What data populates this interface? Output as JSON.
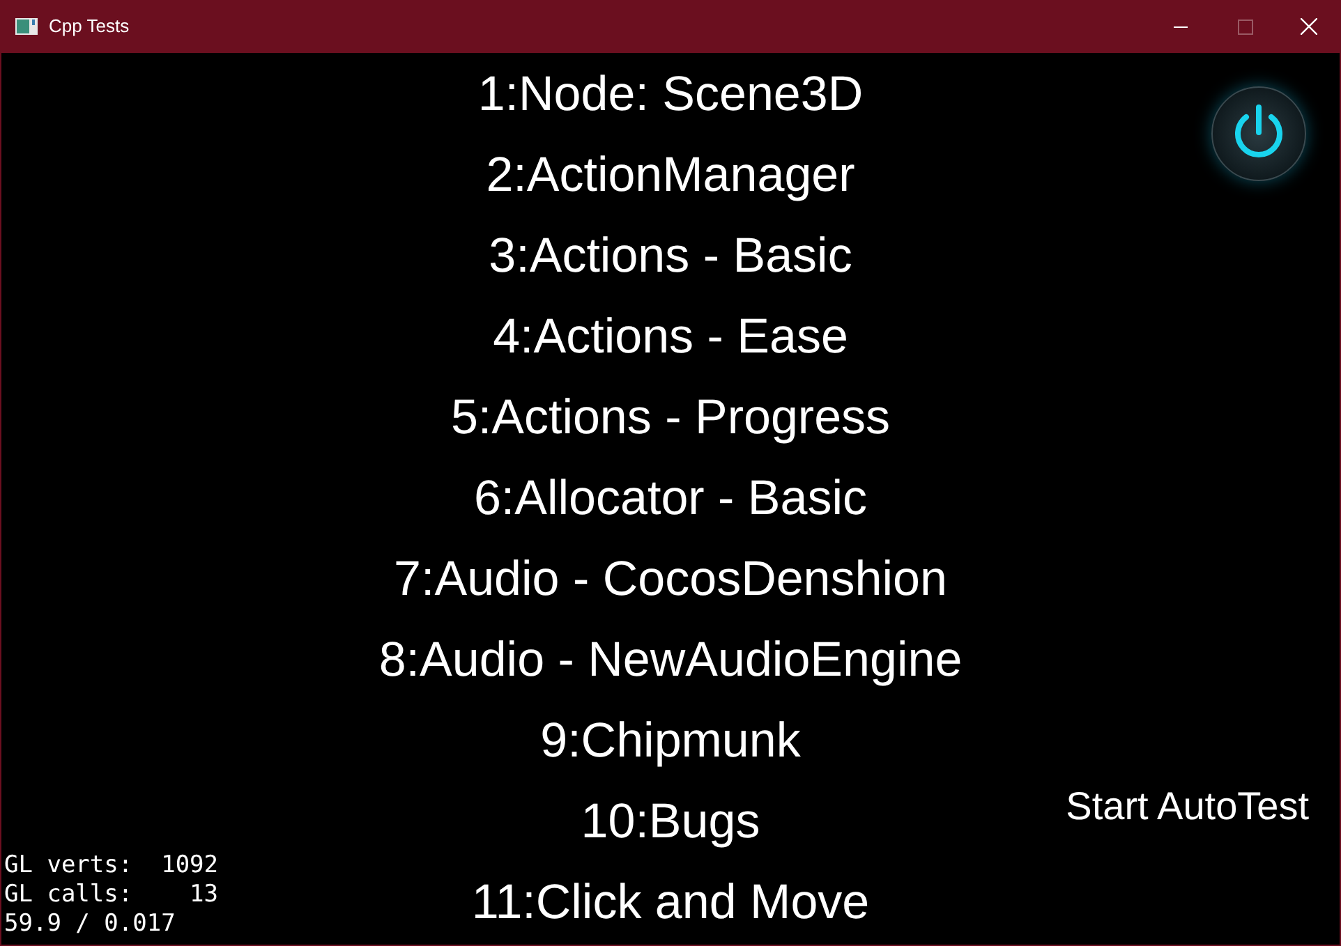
{
  "window": {
    "title": "Cpp Tests"
  },
  "menu": [
    {
      "label": "1:Node: Scene3D"
    },
    {
      "label": "2:ActionManager"
    },
    {
      "label": "3:Actions - Basic"
    },
    {
      "label": "4:Actions - Ease"
    },
    {
      "label": "5:Actions - Progress"
    },
    {
      "label": "6:Allocator - Basic"
    },
    {
      "label": "7:Audio - CocosDenshion"
    },
    {
      "label": "8:Audio - NewAudioEngine"
    },
    {
      "label": "9:Chipmunk"
    },
    {
      "label": "10:Bugs"
    },
    {
      "label": "11:Click and Move"
    }
  ],
  "autotest": {
    "label": "Start AutoTest"
  },
  "stats": [
    "GL verts:  1092",
    "GL calls:    13",
    "59.9 / 0.017"
  ]
}
